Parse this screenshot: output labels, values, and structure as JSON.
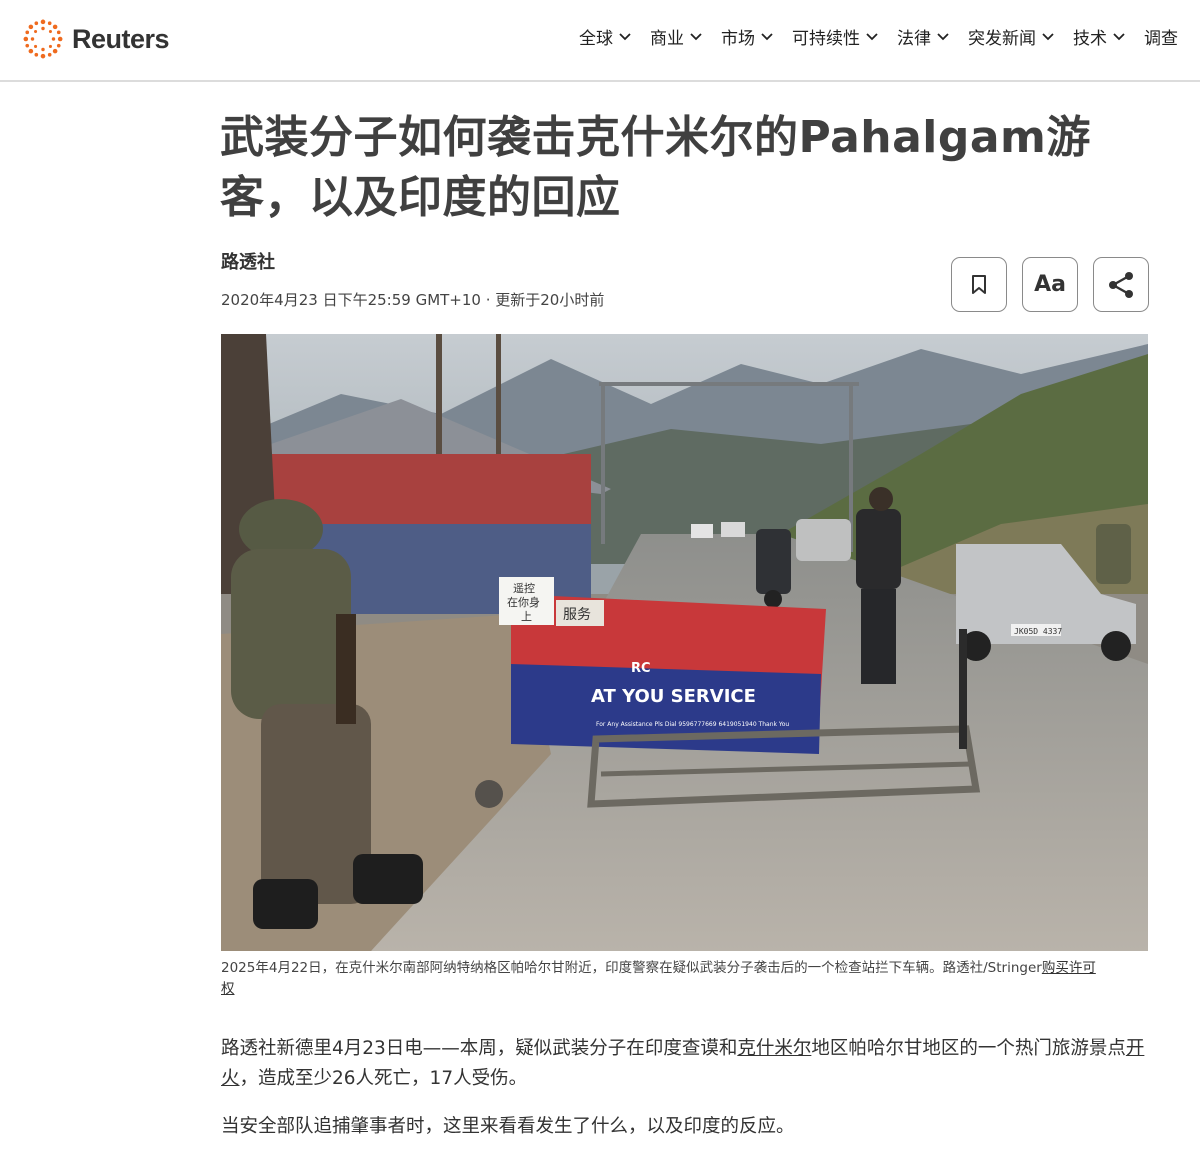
{
  "header": {
    "brand": "Reuters",
    "nav": [
      {
        "label": "全球",
        "has_dropdown": true
      },
      {
        "label": "商业",
        "has_dropdown": true
      },
      {
        "label": "市场",
        "has_dropdown": true
      },
      {
        "label": "可持续性",
        "has_dropdown": true
      },
      {
        "label": "法律",
        "has_dropdown": true
      },
      {
        "label": "突发新闻",
        "has_dropdown": true
      },
      {
        "label": "技术",
        "has_dropdown": true
      },
      {
        "label": "调查",
        "has_dropdown": false
      }
    ]
  },
  "article": {
    "headline": "武装分子如何袭击克什米尔的Pahalgam游客，以及印度的回应",
    "byline": "路透社",
    "dateline": "2020年4月23 日下午25:59 GMT+10 · 更新于20小时前",
    "tools": {
      "bookmark_icon": "bookmark-icon",
      "font_size_label": "Aa",
      "share_icon": "share-icon"
    },
    "image": {
      "sign_small": "遥控\n在你身\n上",
      "sign_service": "服务",
      "barrier_rc": "RC",
      "barrier_text": "AT YOU  SERVICE",
      "barrier_small": "For Any Assistance Pls Dial  9596777669 6419051940 Thank You",
      "plate": "JK05D 4337"
    },
    "caption": {
      "text": "2025年4月22日，在克什米尔南部阿纳特纳格区帕哈尔甘附近，印度警察在疑似武装分子袭击后的一个检查站拦下车辆。路透社/Stringer",
      "link": "购买许可权"
    },
    "paragraph1": {
      "part1": "路透社新德里4月23日电——本周，疑似武装分子在印度查谟和",
      "link1": "克什米尔",
      "part2": "地区帕哈尔甘地区的一个热门旅游景点",
      "link2": "开火",
      "part3": "，造成至少26人死亡，17人受伤。"
    },
    "paragraph2": "当安全部队追捕肇事者时，这里来看看发生了什么，以及印度的反应。"
  },
  "colors": {
    "brand_orange": "#ef6b1f",
    "text_dark": "#333333",
    "headline": "#404040"
  }
}
